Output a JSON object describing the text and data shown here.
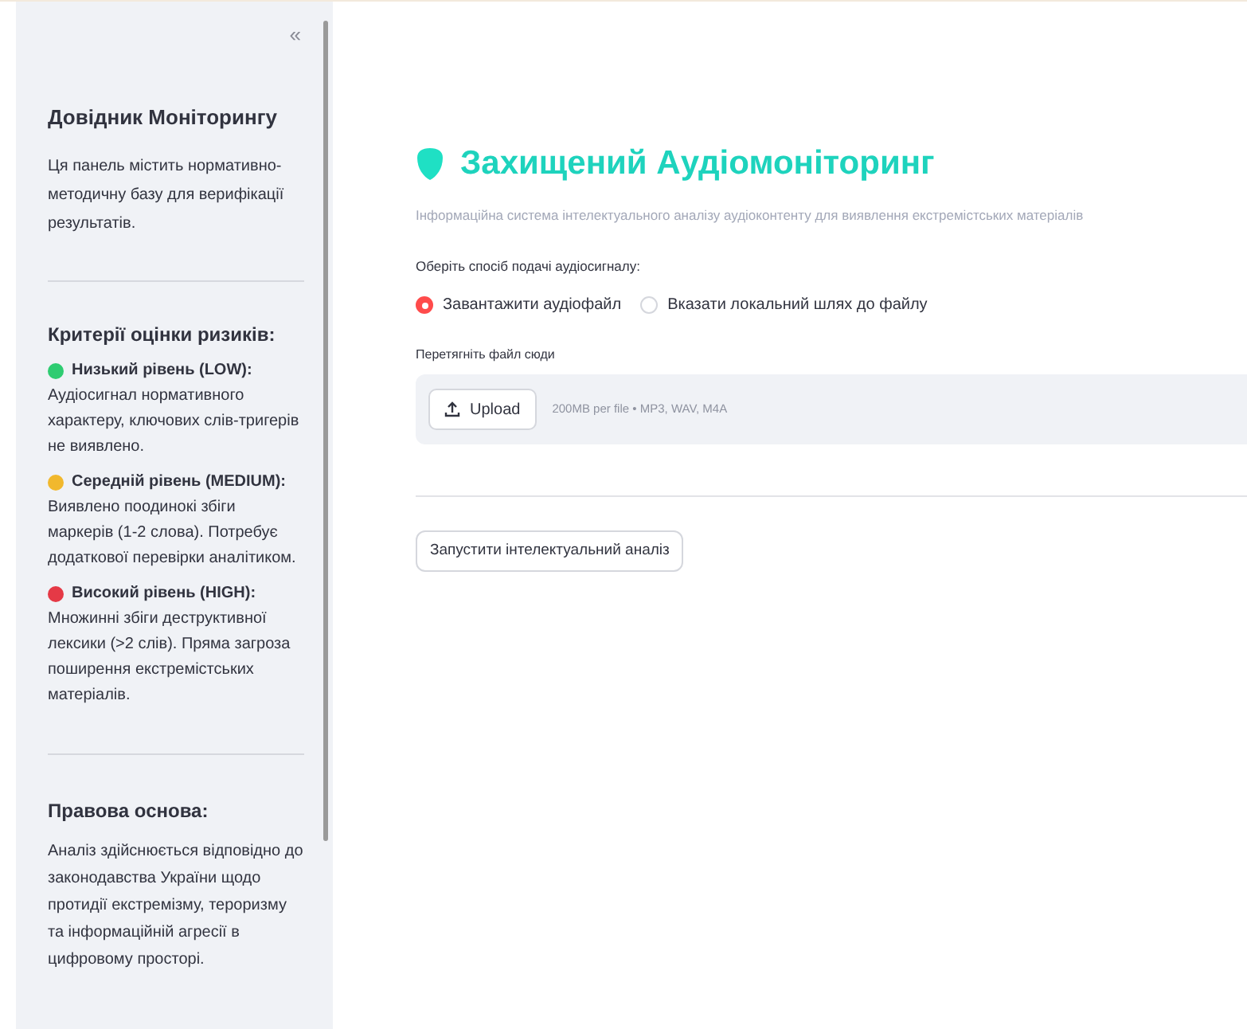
{
  "sidebar": {
    "collapse": "«",
    "title": "Довідник Моніторингу",
    "intro": "Ця панель містить нормативно-методичну базу для верифікації результатів.",
    "criteria_title": "Критерії оцінки ризиків:",
    "levels": [
      {
        "name": "Низький рівень (LOW):",
        "color": "#2ecc71",
        "description": "Аудіосигнал нормативного характеру, ключових слів-тригерів не виявлено."
      },
      {
        "name": "Середній рівень (MEDIUM):",
        "color": "#f1b82d",
        "description": "Виявлено поодинокі збіги маркерів (1-2 слова). Потребує додаткової перевірки аналітиком."
      },
      {
        "name": "Високий рівень (HIGH):",
        "color": "#e53946",
        "description": "Множинні збіги деструктивної лексики (>2 слів). Пряма загроза поширення екстремістських матеріалів."
      }
    ],
    "legal_title": "Правова основа:",
    "legal_text": "Аналіз здійснюється відповідно до законодавства України щодо протидії екстремізму, тероризму та інформаційній агресії в цифровому просторі."
  },
  "main": {
    "title": "Захищений Аудіомоніторинг",
    "subtitle": "Інформаційна система інтелектуального аналізу аудіоконтенту для виявлення екстремістських матеріалів",
    "source_label": "Оберіть спосіб подачі аудіосигналу:",
    "sources": [
      {
        "label": "Завантажити аудіофайл",
        "selected": true
      },
      {
        "label": "Вказати локальний шлях до файлу",
        "selected": false
      }
    ],
    "drop_label": "Перетягніть файл сюди",
    "upload_button": "Upload",
    "upload_hint": "200MB per file • MP3, WAV, M4A",
    "run_button": "Запустити інтелектуальний аналіз"
  }
}
